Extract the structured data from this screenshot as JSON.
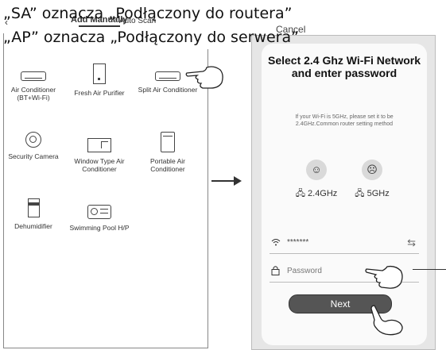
{
  "captions": {
    "line1": "„SA” oznacza „Podłączony do routera”",
    "line2": "„AP” oznacza „Podłączony do serwera”"
  },
  "left_screen": {
    "tab_active": "Add Manually",
    "tab_auto": "Auto Scan",
    "devices": [
      {
        "icon": "air-conditioner-icon",
        "label": "Air Conditioner (BT+Wi-Fi)"
      },
      {
        "icon": "air-purifier-icon",
        "label": "Fresh Air Purifier"
      },
      {
        "icon": "split-air-conditioner-icon",
        "label": "Split Air Conditioner"
      },
      {
        "icon": "security-camera-icon",
        "label": "Security Camera"
      },
      {
        "icon": "window-ac-icon",
        "label": "Window Type Air Conditioner"
      },
      {
        "icon": "portable-ac-icon",
        "label": "Portable Air Conditioner"
      },
      {
        "icon": "dehumidifier-icon",
        "label": "Dehumidifier"
      },
      {
        "icon": "pool-heat-pump-icon",
        "label": "Swimming Pool H/P"
      }
    ]
  },
  "right_screen": {
    "cancel": "Cancel",
    "title": "Select 2.4 Ghz Wi-Fi Network and enter password",
    "subtitle": "If your Wi-Fi is 5GHz, please set it to be 2.4GHz.Common router setting method",
    "bands": [
      {
        "icon": "smile-face-icon",
        "glyph": "☺",
        "label": "2.4GHz"
      },
      {
        "icon": "sad-face-icon",
        "glyph": "☹",
        "label": "5GHz"
      }
    ],
    "ssid_value": "*******",
    "password_placeholder": "Password",
    "next_label": "Next"
  }
}
